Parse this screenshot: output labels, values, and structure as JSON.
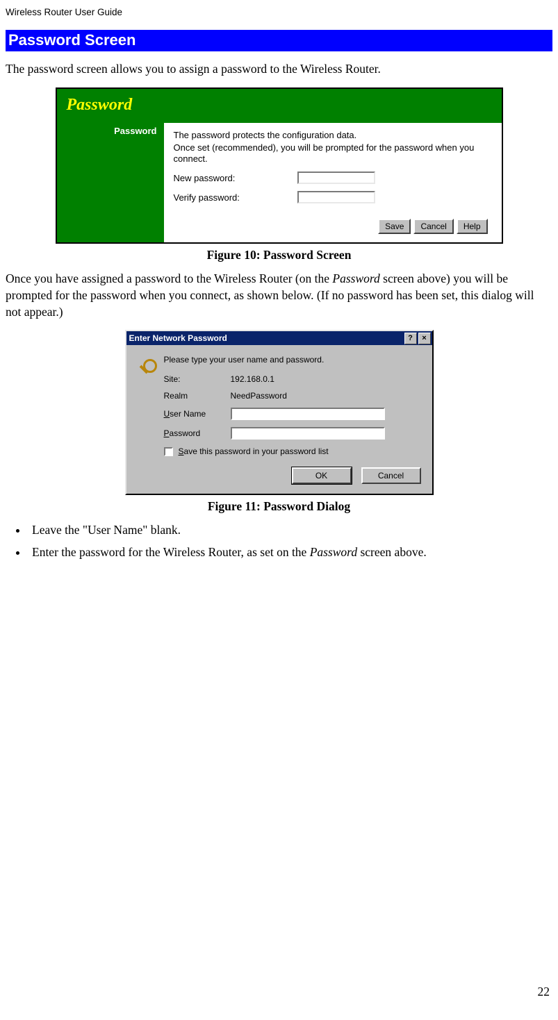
{
  "doc_header": "Wireless Router User Guide",
  "section_title": "Password Screen",
  "intro_text": "The password screen allows you to assign a password to the Wireless Router.",
  "fig10": {
    "panel_title": "Password",
    "sidebar_label": "Password",
    "desc_line1": "The password protects the configuration data.",
    "desc_line2": "Once set (recommended), you will be prompted for the password when you connect.",
    "new_password_label": "New password:",
    "verify_password_label": "Verify password:",
    "buttons": {
      "save": "Save",
      "cancel": "Cancel",
      "help": "Help"
    },
    "caption": "Figure 10: Password Screen"
  },
  "mid_text": "Once you have assigned a password to the Wireless Router (on the Password screen above) you will be prompted for the password when you connect, as shown below. (If no password has been set, this dialog will not appear.)",
  "fig11": {
    "title": "Enter Network Password",
    "help_glyph": "?",
    "close_glyph": "×",
    "prompt": "Please type your user name and password.",
    "site_label": "Site:",
    "site_value": "192.168.0.1",
    "realm_label": "Realm",
    "realm_value": "NeedPassword",
    "user_label_pre": "U",
    "user_label_rest": "ser Name",
    "pass_label_pre": "P",
    "pass_label_rest": "assword",
    "save_check_pre": "S",
    "save_check_rest": "ave this password in your password list",
    "ok": "OK",
    "cancel": "Cancel",
    "caption": "Figure 11: Password Dialog"
  },
  "bullets": {
    "b1": "Leave the \"User Name\" blank.",
    "b2_pre": "Enter the password for the Wireless Router, as set on the ",
    "b2_em": "Password",
    "b2_post": " screen above."
  },
  "page_number": "22"
}
